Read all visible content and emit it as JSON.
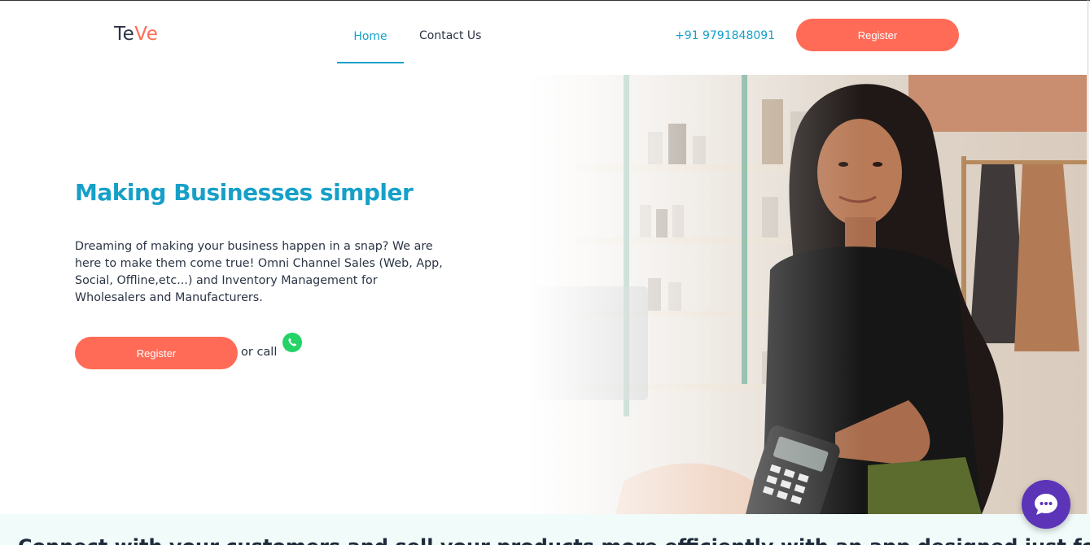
{
  "header": {
    "logo_part1": "Te",
    "logo_part2": "Ve",
    "nav": {
      "home": "Home",
      "contact": "Contact Us"
    },
    "phone": "+91 9791848091",
    "register_label": "Register"
  },
  "hero": {
    "title": "Making Businesses simpler",
    "description": "Dreaming of making your business happen in a snap? We are here to make them come true! Omni Channel Sales (Web, App, Social, Offline,etc...) and Inventory Management for Wholesalers and Manufacturers.",
    "register_label": "Register",
    "or_call": "or call"
  },
  "band": {
    "text": "Connect with your customers and sell your products more efficiently with an app designed just for you. But that is not all!"
  },
  "icons": {
    "whatsapp": "whatsapp-icon",
    "chat": "chat-icon"
  },
  "colors": {
    "accent": "#16a0c8",
    "brand": "#ff6b57",
    "chat": "#5b34b8",
    "band_bg": "#f1fbfa"
  }
}
